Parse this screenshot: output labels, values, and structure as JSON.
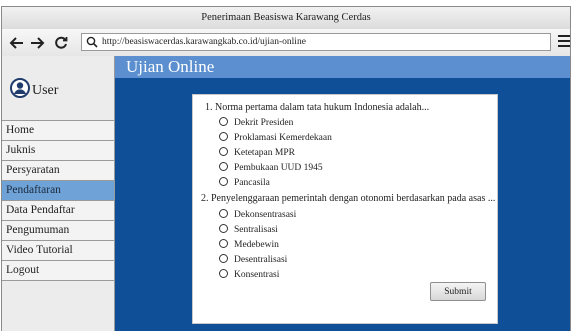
{
  "window": {
    "title": "Penerimaan Beasiswa Karawang Cerdas"
  },
  "browser": {
    "url": "http://beasiswacerdas.karawangkab.co.id/ujian-online",
    "icons": [
      "back-arrow-icon",
      "forward-arrow-icon",
      "reload-icon",
      "search-icon",
      "hamburger-menu-icon"
    ]
  },
  "sidebar": {
    "user_label": "User",
    "items": [
      {
        "label": "Home",
        "active": false
      },
      {
        "label": "Juknis",
        "active": false
      },
      {
        "label": "Persyaratan",
        "active": false
      },
      {
        "label": "Pendaftaran",
        "active": true
      },
      {
        "label": "Data Pendaftar",
        "active": false
      },
      {
        "label": "Pengumuman",
        "active": false
      },
      {
        "label": "Video Tutorial",
        "active": false
      },
      {
        "label": "Logout",
        "active": false
      }
    ]
  },
  "main": {
    "title": "Ujian Online",
    "questions": [
      {
        "text": "1. Norma pertama dalam tata hukum Indonesia adalah...",
        "options": [
          "Dekrit Presiden",
          "Proklamasi Kemerdekaan",
          "Ketetapan MPR",
          "Pembukaan UUD 1945",
          "Pancasila"
        ]
      },
      {
        "text": "2. Penyelenggaraan pemerintah dengan otonomi berdasarkan pada asas ...",
        "options": [
          "Dekonsentrasasi",
          "Sentralisasi",
          "Medebewin",
          "Desentralisasi",
          "Konsentrasi"
        ]
      }
    ],
    "submit_label": "Submit"
  },
  "colors": {
    "sidebar_active": "#6fa3d8",
    "content_bg": "#0e4f98",
    "header_bg": "#5b8fd0"
  }
}
